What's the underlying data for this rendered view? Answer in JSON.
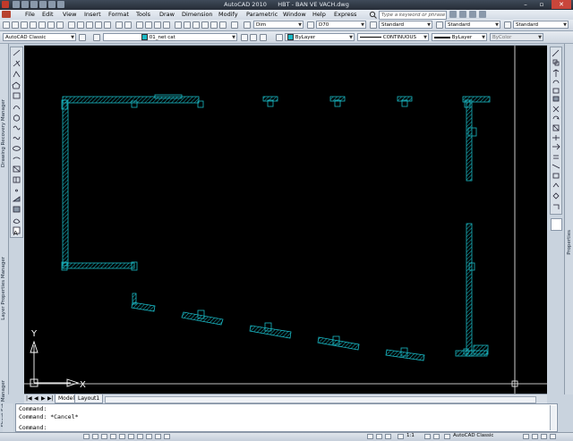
{
  "window": {
    "app": "AutoCAD 2010",
    "file": "HBT - BAN VE VACH.dwg",
    "search_placeholder": "Type a keyword or phrase"
  },
  "menu": [
    "File",
    "Edit",
    "View",
    "Insert",
    "Format",
    "Tools",
    "Draw",
    "Dimension",
    "Modify",
    "Parametric",
    "Window",
    "Help",
    "Express"
  ],
  "toolbar1": {
    "dim_style": "Dim",
    "text_style": "D70",
    "table_style": "Standard",
    "multileader_style": "Standard"
  },
  "toolbar2": {
    "workspace": "AutoCAD Classic",
    "layer": "01_net cat",
    "color": "ByLayer",
    "linetype": "CONTINUOUS",
    "lineweight": "ByLayer",
    "plotstyle": "ByColor"
  },
  "panels": {
    "drawing_recovery": "Drawing Recovery Manager",
    "layer_properties": "Layer Properties Manager",
    "sheet_set": "Sheet Set Manager",
    "properties": "Properties"
  },
  "ucs": {
    "y_label": "Y",
    "x_label": "X"
  },
  "tabs": [
    "Model",
    "Layout1"
  ],
  "command": {
    "lines": [
      "Command:",
      "Command: *Cancel*",
      "Command:"
    ]
  },
  "status": {
    "scale": "1:1",
    "workspace": "AutoCAD Classic"
  },
  "colors": {
    "wall": "#19b8c4",
    "canvas": "#000000"
  }
}
